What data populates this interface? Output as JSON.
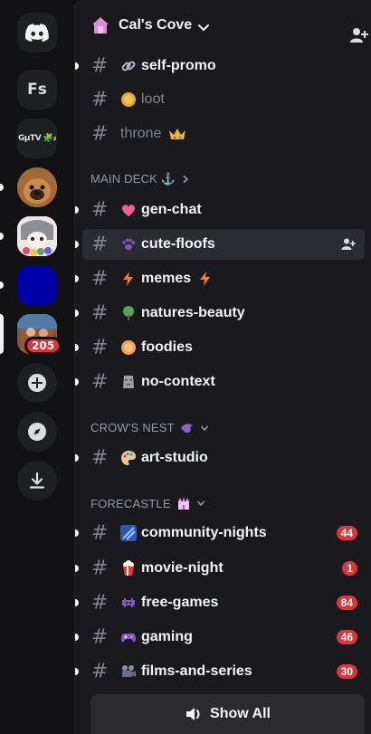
{
  "rail": {
    "servers": [
      {
        "name": "discord-home",
        "text": ""
      },
      {
        "name": "server-fs",
        "text": "Fs"
      },
      {
        "name": "server-gs",
        "text": "GµTV 🧩₂"
      },
      {
        "name": "server-dog",
        "text": ""
      },
      {
        "name": "server-anime",
        "text": ""
      },
      {
        "name": "server-blue",
        "text": ""
      },
      {
        "name": "server-selected",
        "text": ""
      }
    ],
    "badge": "205"
  },
  "guild": {
    "name": "Cal's Cove"
  },
  "channels_top": [
    {
      "name": "self-promo",
      "emoji": "link-icon",
      "unread": true,
      "muted": false
    },
    {
      "name": "loot",
      "emoji": "coin-icon",
      "unread": false,
      "muted": true
    },
    {
      "name": "throne",
      "emoji": "crown-icon",
      "unread": false,
      "muted": true
    }
  ],
  "categories": {
    "main_deck": "MAIN DECK ⚓",
    "crows_nest": "CROW'S NEST",
    "forecastle": "FORECASTLE"
  },
  "main_deck_channels": [
    {
      "name": "gen-chat",
      "emoji": "heart-icon"
    },
    {
      "name": "cute-floofs",
      "emoji": "paw-icon"
    },
    {
      "name": "memes",
      "emoji": "bolt-icon"
    },
    {
      "name": "natures-beauty",
      "emoji": "tree-icon"
    },
    {
      "name": "foodies",
      "emoji": "peach-icon"
    },
    {
      "name": "no-context",
      "emoji": "moai-icon"
    }
  ],
  "crows_nest_channels": [
    {
      "name": "art-studio",
      "emoji": "palette-icon"
    }
  ],
  "forecastle_channels": [
    {
      "name": "community-nights",
      "emoji": "sparkle-icon",
      "count": "44"
    },
    {
      "name": "movie-night",
      "emoji": "popcorn-icon",
      "count": "1"
    },
    {
      "name": "free-games",
      "emoji": "invader-icon",
      "count": "84"
    },
    {
      "name": "gaming",
      "emoji": "gamepad-icon",
      "count": "46"
    },
    {
      "name": "films-and-series",
      "emoji": "camera-icon",
      "count": "30"
    }
  ],
  "show_all": "Show All",
  "colors": {
    "badge": "#da373c",
    "panel": "#1a1a1e",
    "rail": "#121214"
  }
}
